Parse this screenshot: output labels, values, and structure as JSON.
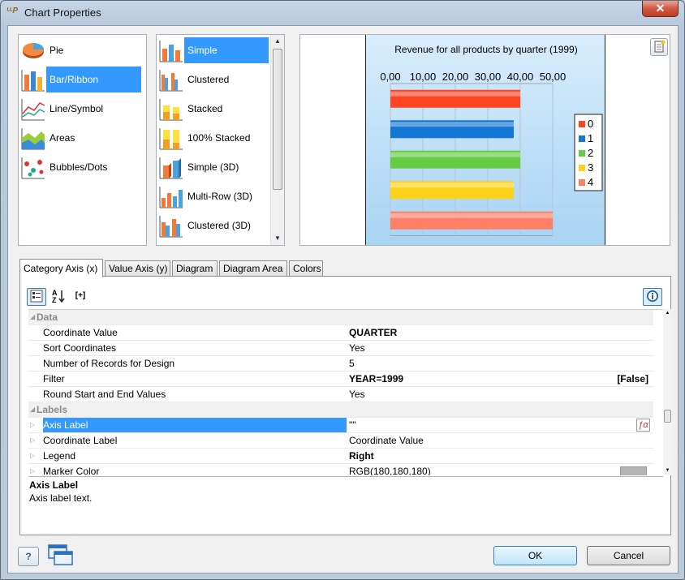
{
  "window": {
    "title": "Chart Properties",
    "app_icon_text": "ᴸᴸP",
    "close_label": "✕"
  },
  "chart_types": [
    {
      "label": "Pie",
      "icon": "pie-chart-icon",
      "selected": false
    },
    {
      "label": "Bar/Ribbon",
      "icon": "bar-chart-icon",
      "selected": true
    },
    {
      "label": "Line/Symbol",
      "icon": "line-chart-icon",
      "selected": false
    },
    {
      "label": "Areas",
      "icon": "area-chart-icon",
      "selected": false
    },
    {
      "label": "Bubbles/Dots",
      "icon": "bubble-chart-icon",
      "selected": false
    }
  ],
  "subtypes": [
    {
      "label": "Simple",
      "icon": "simple-bar-icon",
      "selected": true
    },
    {
      "label": "Clustered",
      "icon": "clustered-bar-icon",
      "selected": false
    },
    {
      "label": "Stacked",
      "icon": "stacked-bar-icon",
      "selected": false
    },
    {
      "label": "100% Stacked",
      "icon": "percent-stacked-bar-icon",
      "selected": false
    },
    {
      "label": "Simple (3D)",
      "icon": "simple-3d-bar-icon",
      "selected": false
    },
    {
      "label": "Multi-Row (3D)",
      "icon": "multirow-3d-bar-icon",
      "selected": false
    },
    {
      "label": "Clustered (3D)",
      "icon": "clustered-3d-bar-icon",
      "selected": false
    }
  ],
  "chart_data": {
    "type": "bar",
    "orientation": "horizontal",
    "title": "Revenue for all products by quarter (1999)",
    "categories": [
      "0",
      "1",
      "2",
      "3",
      "4"
    ],
    "values": [
      40,
      38,
      40,
      38,
      50
    ],
    "xlim": [
      0,
      50
    ],
    "ticks": [
      "0,00",
      "10,00",
      "20,00",
      "30,00",
      "40,00",
      "50,00"
    ],
    "tick_values": [
      0,
      10,
      20,
      30,
      40,
      50
    ],
    "colors": [
      "#ff4422",
      "#1577d4",
      "#66cc44",
      "#ffd21a",
      "#ff7f66"
    ],
    "legend": {
      "position": "right",
      "entries": [
        "0",
        "1",
        "2",
        "3",
        "4"
      ]
    },
    "grid": true
  },
  "tabs": [
    {
      "label": "Category Axis (x)",
      "active": true
    },
    {
      "label": "Value Axis (y)",
      "active": false
    },
    {
      "label": "Diagram",
      "active": false
    },
    {
      "label": "Diagram Area",
      "active": false
    },
    {
      "label": "Colors",
      "active": false
    }
  ],
  "toolbar": {
    "categorized_icon": "categorized-icon",
    "alpha_label": "A\nZ",
    "expand_label": "[+]",
    "info_icon": "info-icon"
  },
  "properties": {
    "data_category": "Data",
    "data_rows": [
      {
        "name": "Coordinate Value",
        "value": "QUARTER",
        "bold": true
      },
      {
        "name": "Sort Coordinates",
        "value": "Yes"
      },
      {
        "name": "Number of Records for Design",
        "value": "5"
      },
      {
        "name": "Filter",
        "value": "YEAR=1999",
        "bold": true,
        "extra": "[False]"
      },
      {
        "name": "Round Start and End Values",
        "value": "Yes"
      }
    ],
    "labels_category": "Labels",
    "labels_rows": [
      {
        "name": "Axis Label",
        "value": "\"\"",
        "selected": true
      },
      {
        "name": "Coordinate Label",
        "value": "Coordinate Value"
      },
      {
        "name": "Legend",
        "value": "Right",
        "bold": true
      },
      {
        "name": "Marker Color",
        "value": "RGB(180,180,180)",
        "swatch": "#b4b4b4"
      }
    ]
  },
  "description": {
    "title": "Axis Label",
    "text": "Axis label text."
  },
  "buttons": {
    "ok": "OK",
    "cancel": "Cancel",
    "help": "?"
  }
}
